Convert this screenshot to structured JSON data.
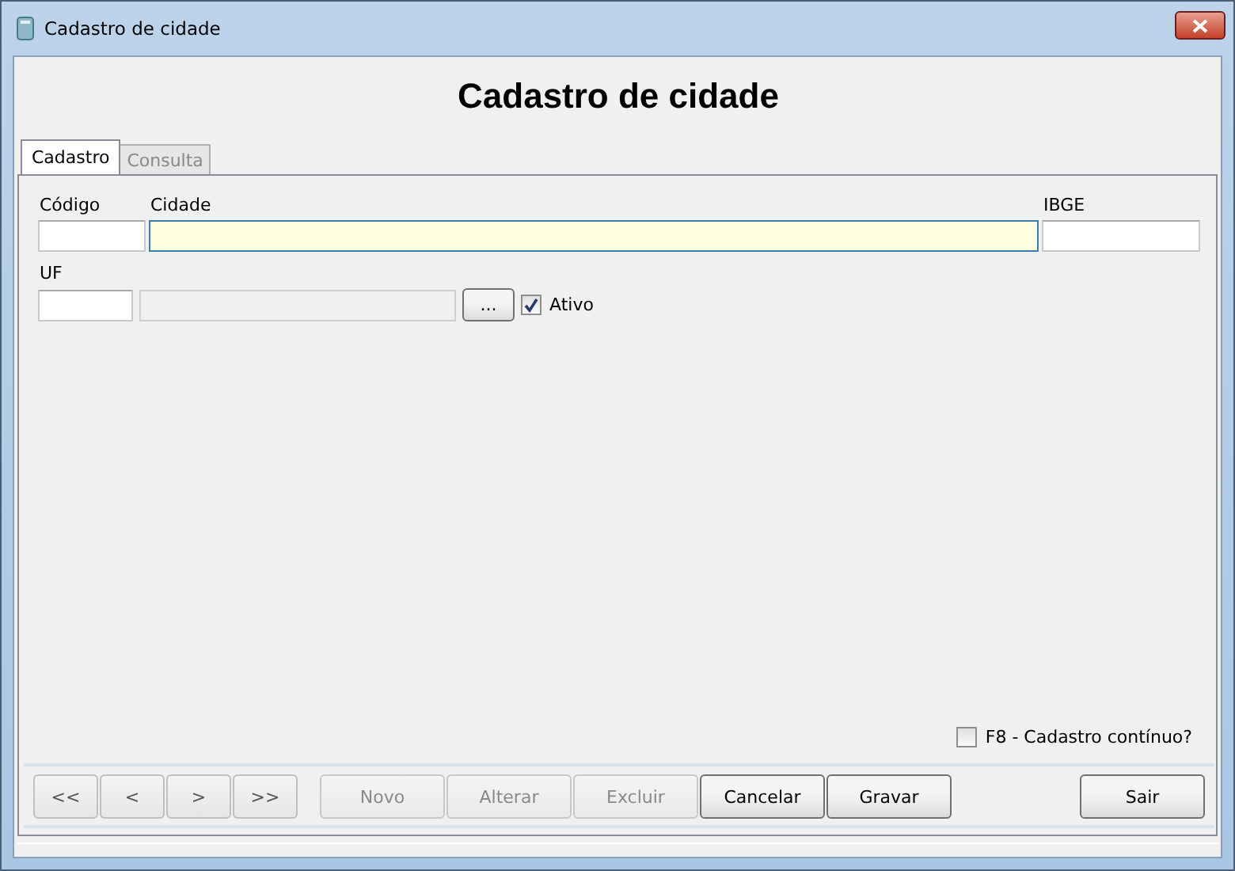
{
  "window": {
    "title": "Cadastro de cidade"
  },
  "heading": "Cadastro de cidade",
  "tabs": [
    {
      "label": "Cadastro",
      "selected": true
    },
    {
      "label": "Consulta",
      "selected": false
    }
  ],
  "fields": {
    "codigo": {
      "label": "Código"
    },
    "cidade": {
      "label": "Cidade",
      "focused": true
    },
    "ibge": {
      "label": "IBGE"
    },
    "uf": {
      "label": "UF"
    },
    "lookup_button": "...",
    "ativo": {
      "label": "Ativo",
      "checked": true
    }
  },
  "continuous": {
    "label": "F8 - Cadastro contínuo?",
    "checked": false
  },
  "nav_buttons": [
    {
      "label": "<<",
      "disabled": false
    },
    {
      "label": "<",
      "disabled": false
    },
    {
      "label": ">",
      "disabled": false
    },
    {
      "label": ">>",
      "disabled": false
    }
  ],
  "action_buttons": [
    {
      "label": "Novo",
      "disabled": true
    },
    {
      "label": "Alterar",
      "disabled": true
    },
    {
      "label": "Excluir",
      "disabled": true
    },
    {
      "label": "Cancelar",
      "disabled": false
    },
    {
      "label": "Gravar",
      "disabled": false
    }
  ],
  "exit_button": {
    "label": "Sair",
    "disabled": false
  }
}
